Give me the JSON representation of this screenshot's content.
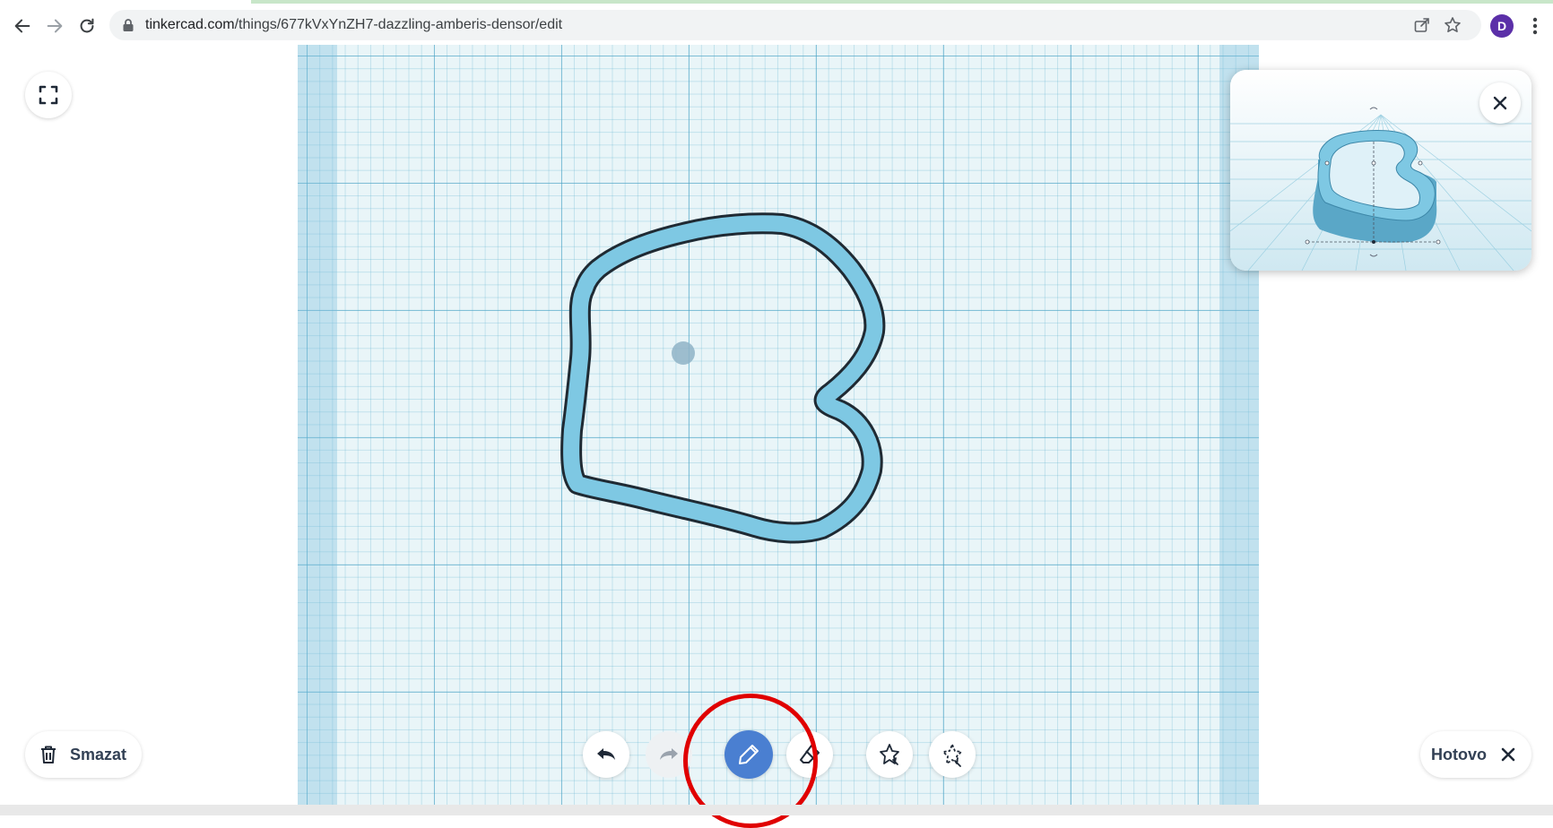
{
  "browser": {
    "url_host": "tinkercad.com",
    "url_path": "/things/677kVxYnZH7-dazzling-amberis-densor/edit",
    "profile_initial": "D",
    "icons": [
      "back-arrow-icon",
      "forward-arrow-icon",
      "reload-icon",
      "lock-icon",
      "share-icon",
      "star-icon",
      "kebab-menu-icon"
    ]
  },
  "editor": {
    "delete_label": "Smazat",
    "done_label": "Hotovo",
    "toolbar": [
      "undo-icon",
      "redo-icon",
      "pencil-icon",
      "eraser-icon",
      "shape-add-icon",
      "shape-remove-icon"
    ],
    "active_tool": "pencil",
    "shape_fill": "#7ec8e3",
    "shape_stroke": "#1f2a33",
    "annotation_color": "#e00000",
    "active_tool_color": "#4a7fd1"
  }
}
